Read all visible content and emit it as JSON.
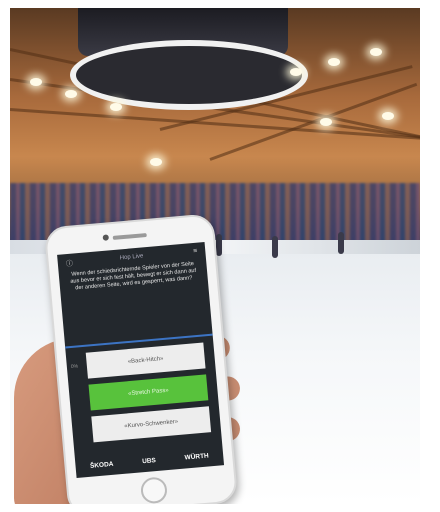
{
  "scene": "ice-hockey-arena",
  "phone_app": {
    "header": "Hop Live",
    "instruction": "Wenn der schiedsrichternde Spieler von der Seite aus bevor er sich fest hält, bewegt er sich dann auf der anderen Seite, wird es gesperrt, was dann?",
    "options": [
      {
        "label": "«Back-Hitch»",
        "percent": "0%"
      },
      {
        "label": "«Stretch Pass»",
        "percent": ""
      },
      {
        "label": "«Kurvo-Schwenker»",
        "percent": ""
      }
    ],
    "sponsors": [
      "ŠKODA",
      "UBS",
      "WÜRTH"
    ]
  },
  "colors": {
    "screen_bg": "#23282d",
    "selected_option": "#58c23c",
    "divider": "#3c74c4"
  }
}
